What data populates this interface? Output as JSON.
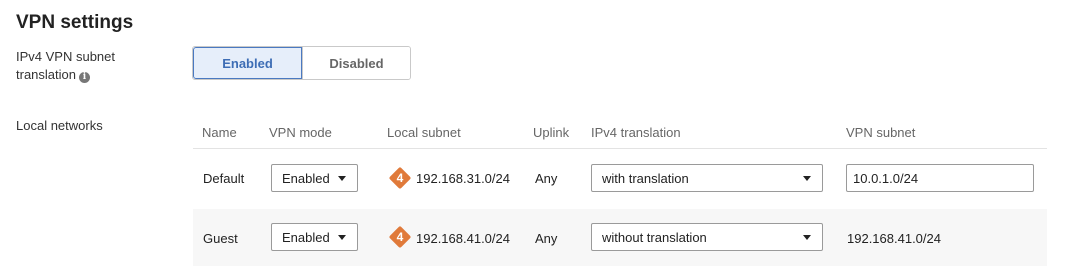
{
  "section": {
    "title": "VPN settings"
  },
  "ipv4_translation": {
    "label_line1": "IPv4 VPN subnet",
    "label_line2": "translation",
    "info_icon": "info-icon",
    "options": [
      "Enabled",
      "Disabled"
    ],
    "selected": "Enabled"
  },
  "local_networks": {
    "label": "Local networks",
    "columns": [
      "Name",
      "VPN mode",
      "Local subnet",
      "Uplink",
      "IPv4 translation",
      "VPN subnet"
    ],
    "rows": [
      {
        "name": "Default",
        "vpn_mode": "Enabled",
        "badge": "4",
        "local_subnet": "192.168.31.0/24",
        "uplink": "Any",
        "ipv4_translation": "with translation",
        "vpn_subnet": "10.0.1.0/24",
        "vpn_subnet_editable": true
      },
      {
        "name": "Guest",
        "vpn_mode": "Enabled",
        "badge": "4",
        "local_subnet": "192.168.41.0/24",
        "uplink": "Any",
        "ipv4_translation": "without translation",
        "vpn_subnet": "192.168.41.0/24",
        "vpn_subnet_editable": false
      }
    ]
  },
  "colors": {
    "accent": "#4a79c1",
    "badge": "#e07a3a",
    "row_alt": "#f7f7f7"
  }
}
